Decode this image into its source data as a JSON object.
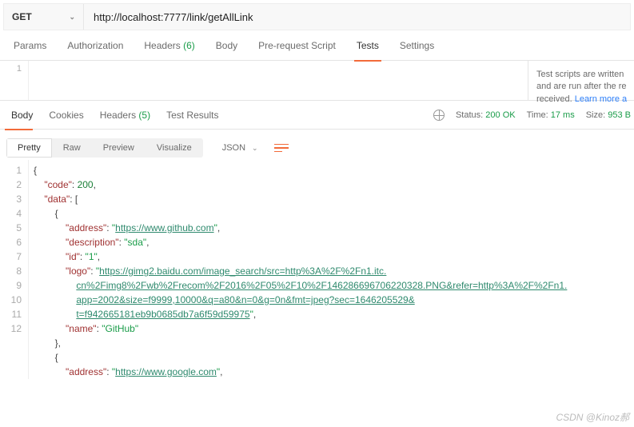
{
  "request": {
    "method": "GET",
    "url": "http://localhost:7777/link/getAllLink"
  },
  "tabs": {
    "params": "Params",
    "auth": "Authorization",
    "headers": "Headers",
    "headers_count": "(6)",
    "body": "Body",
    "prerequest": "Pre-request Script",
    "tests": "Tests",
    "settings": "Settings"
  },
  "editor": {
    "line1": "1"
  },
  "help": {
    "line1": "Test scripts are written",
    "line2": "and are run after the re",
    "line3": "received. ",
    "learn": "Learn more a"
  },
  "response": {
    "tabs": {
      "body": "Body",
      "cookies": "Cookies",
      "headers": "Headers",
      "headers_count": "(5)",
      "testresults": "Test Results"
    },
    "meta": {
      "status_label": "Status:",
      "status_value": "200 OK",
      "time_label": "Time:",
      "time_value": "17 ms",
      "size_label": "Size:",
      "size_value": "953 B"
    },
    "view": {
      "pretty": "Pretty",
      "raw": "Raw",
      "preview": "Preview",
      "visualize": "Visualize",
      "format": "JSON"
    },
    "json_lines": [
      "1",
      "2",
      "3",
      "4",
      "5",
      "6",
      "7",
      "8",
      "",
      "",
      "",
      "9",
      "10",
      "11",
      "12",
      ""
    ],
    "json_data": {
      "code": 200,
      "data": [
        {
          "address": "https://www.github.com",
          "description": "sda",
          "id": "1",
          "logo": "https://gimg2.baidu.com/image_search/src=http%3A%2F%2Fn1.itc.cn%2Fimg8%2Fwb%2Frecom%2F2016%2F05%2F10%2F146286696706220328.PNG&refer=http%3A%2F%2Fn1.app=2002&size=f9999,10000&q=a80&n=0&g=0n&fmt=jpeg?sec=1646205529&t=f942665181eb9b0685db7a6f59d59975",
          "name": "GitHub"
        },
        {
          "address": "https://www.google.com"
        }
      ]
    }
  },
  "watermark": "CSDN @Kinoz郝"
}
